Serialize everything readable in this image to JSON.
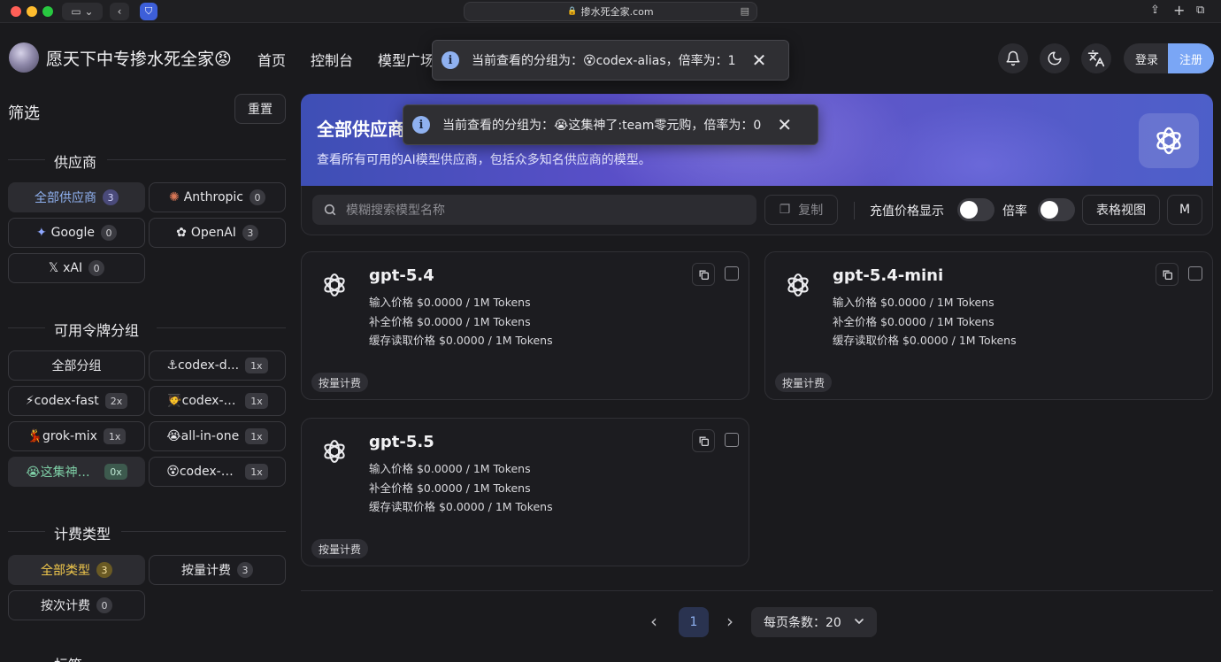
{
  "browser": {
    "address": "掺水死全家.com"
  },
  "nav": {
    "site_title": "愿天下中专掺水死全家😡",
    "links": [
      "首页",
      "控制台",
      "模型广场"
    ],
    "login": "登录",
    "register": "注册"
  },
  "toasts": [
    {
      "text": "当前查看的分组为：😵codex-alias，倍率为：1"
    },
    {
      "text": "当前查看的分组为：😭这集神了:team零元购，倍率为：0"
    }
  ],
  "sidebar": {
    "title": "筛选",
    "reset": "重置",
    "providers_title": "供应商",
    "providers": [
      {
        "icon": "",
        "label": "全部供应商",
        "count": "3"
      },
      {
        "icon": "✺",
        "label": "Anthropic",
        "count": "0"
      },
      {
        "icon": "✦",
        "label": "Google",
        "count": "0"
      },
      {
        "icon": "✿",
        "label": "OpenAI",
        "count": "3"
      },
      {
        "icon": "𝕏",
        "label": "xAI",
        "count": "0"
      }
    ],
    "groups_title": "可用令牌分组",
    "groups": [
      {
        "label": "全部分组",
        "mult": ""
      },
      {
        "label": "⚓codex-d...",
        "mult": "1x"
      },
      {
        "label": "⚡codex-fast",
        "mult": "2x"
      },
      {
        "label": "🧑‍🎓codex-n...",
        "mult": "1x"
      },
      {
        "label": "💃grok-mix",
        "mult": "1x"
      },
      {
        "label": "😭all-in-one",
        "mult": "1x"
      },
      {
        "label": "😭这集神了:...",
        "mult": "0x"
      },
      {
        "label": "😵codex-ali...",
        "mult": "1x"
      }
    ],
    "billing_title": "计费类型",
    "billing": [
      {
        "label": "全部类型",
        "count": "3"
      },
      {
        "label": "按量计费",
        "count": "3"
      },
      {
        "label": "按次计费",
        "count": "0"
      }
    ],
    "tags_title": "标签"
  },
  "hero": {
    "title": "全部供应商",
    "desc": "查看所有可用的AI模型供应商，包括众多知名供应商的模型。"
  },
  "toolbar": {
    "search_placeholder": "模糊搜索模型名称",
    "copy": "复制",
    "recharge_price": "充值价格显示",
    "ratio": "倍率",
    "table_view": "表格视图",
    "m": "M"
  },
  "models": [
    {
      "name": "gpt-5.4",
      "input": "输入价格 $0.0000 / 1M Tokens",
      "completion": "补全价格 $0.0000 / 1M Tokens",
      "cache": "缓存读取价格 $0.0000 / 1M Tokens",
      "tag": "按量计费"
    },
    {
      "name": "gpt-5.4-mini",
      "input": "输入价格 $0.0000 / 1M Tokens",
      "completion": "补全价格 $0.0000 / 1M Tokens",
      "cache": "缓存读取价格 $0.0000 / 1M Tokens",
      "tag": "按量计费"
    },
    {
      "name": "gpt-5.5",
      "input": "输入价格 $0.0000 / 1M Tokens",
      "completion": "补全价格 $0.0000 / 1M Tokens",
      "cache": "缓存读取价格 $0.0000 / 1M Tokens",
      "tag": "按量计费"
    }
  ],
  "pagination": {
    "page": "1",
    "page_size": "每页条数：20"
  }
}
